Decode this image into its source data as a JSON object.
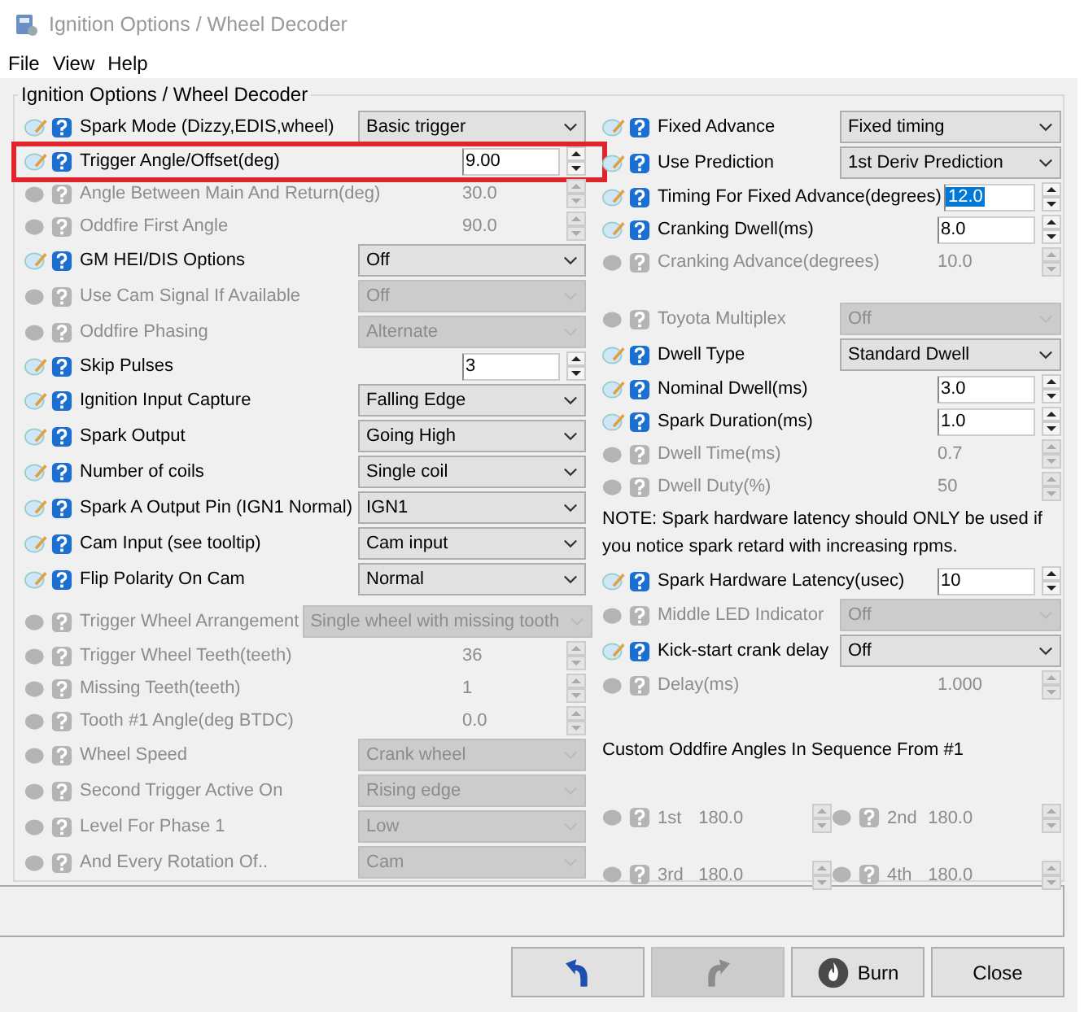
{
  "window": {
    "title": "Ignition Options / Wheel Decoder"
  },
  "menu": [
    "File",
    "View",
    "Help"
  ],
  "group": {
    "title": "Ignition Options / Wheel Decoder"
  },
  "left_rows": [
    {
      "kind": "select",
      "label": "Spark Mode (Dizzy,EDIS,wheel)",
      "value": "Basic trigger",
      "enabled": true
    },
    {
      "kind": "number",
      "label": "Trigger Angle/Offset(deg)",
      "value": "9.00",
      "enabled": true,
      "highlighted": true
    },
    {
      "kind": "number",
      "label": "Angle Between Main And Return(deg)",
      "value": "30.0",
      "enabled": false
    },
    {
      "kind": "number",
      "label": "Oddfire First Angle",
      "value": "90.0",
      "enabled": false
    },
    {
      "kind": "select",
      "label": "GM HEI/DIS Options",
      "value": "Off",
      "enabled": true
    },
    {
      "kind": "select",
      "label": "Use Cam Signal If Available",
      "value": "Off",
      "enabled": false
    },
    {
      "kind": "select",
      "label": "Oddfire Phasing",
      "value": "Alternate",
      "enabled": false
    },
    {
      "kind": "number",
      "label": "Skip Pulses",
      "value": "3",
      "enabled": true
    },
    {
      "kind": "select",
      "label": "Ignition Input Capture",
      "value": "Falling Edge",
      "enabled": true
    },
    {
      "kind": "select",
      "label": "Spark Output",
      "value": "Going High",
      "enabled": true
    },
    {
      "kind": "select",
      "label": "Number of coils",
      "value": "Single coil",
      "enabled": true
    },
    {
      "kind": "select",
      "label": "Spark A Output Pin (IGN1 Normal)",
      "value": "IGN1",
      "enabled": true
    },
    {
      "kind": "select",
      "label": "Cam Input (see tooltip)",
      "value": "Cam input",
      "enabled": true
    },
    {
      "kind": "select",
      "label": "Flip Polarity On Cam",
      "value": "Normal",
      "enabled": true
    },
    {
      "kind": "spacer"
    },
    {
      "kind": "select",
      "label": "Trigger Wheel Arrangement",
      "value": "Single wheel with missing tooth",
      "enabled": false
    },
    {
      "kind": "number",
      "label": "Trigger Wheel Teeth(teeth)",
      "value": "36",
      "enabled": false
    },
    {
      "kind": "number",
      "label": "Missing Teeth(teeth)",
      "value": "1",
      "enabled": false
    },
    {
      "kind": "number",
      "label": "Tooth #1 Angle(deg BTDC)",
      "value": "0.0",
      "enabled": false
    },
    {
      "kind": "select",
      "label": "Wheel Speed",
      "value": "Crank wheel",
      "enabled": false
    },
    {
      "kind": "select",
      "label": "Second Trigger Active On",
      "value": "Rising edge",
      "enabled": false
    },
    {
      "kind": "select",
      "label": "Level For Phase 1",
      "value": "Low",
      "enabled": false
    },
    {
      "kind": "select",
      "label": "And Every Rotation Of..",
      "value": "Cam",
      "enabled": false
    }
  ],
  "right_rows": [
    {
      "kind": "select",
      "label": "Fixed Advance",
      "value": "Fixed timing",
      "enabled": true
    },
    {
      "kind": "select",
      "label": "Use Prediction",
      "value": "1st Deriv Prediction",
      "enabled": true
    },
    {
      "kind": "number",
      "label": "Timing For Fixed Advance(degrees)",
      "value": "12.0",
      "enabled": true,
      "selected": true
    },
    {
      "kind": "number",
      "label": "Cranking Dwell(ms)",
      "value": "8.0",
      "enabled": true,
      "selected": false
    },
    {
      "kind": "number",
      "label": "Cranking Advance(degrees)",
      "value": "10.0",
      "enabled": false
    },
    {
      "kind": "spacer"
    },
    {
      "kind": "select",
      "label": "Toyota Multiplex",
      "value": "Off",
      "enabled": false
    },
    {
      "kind": "select",
      "label": "Dwell Type",
      "value": "Standard Dwell",
      "enabled": true
    },
    {
      "kind": "number",
      "label": "Nominal Dwell(ms)",
      "value": "3.0",
      "enabled": true,
      "selected": false
    },
    {
      "kind": "number",
      "label": "Spark Duration(ms)",
      "value": "1.0",
      "enabled": true,
      "selected": false
    },
    {
      "kind": "number",
      "label": "Dwell Time(ms)",
      "value": "0.7",
      "enabled": false
    },
    {
      "kind": "number",
      "label": "Dwell Duty(%)",
      "value": "50",
      "enabled": false
    },
    {
      "kind": "note",
      "text": "NOTE: Spark hardware latency should ONLY be used if you notice spark retard with increasing rpms."
    },
    {
      "kind": "number",
      "label": "Spark Hardware Latency(usec)",
      "value": "10",
      "enabled": true,
      "selected": false
    },
    {
      "kind": "select",
      "label": "Middle LED Indicator",
      "value": "Off",
      "enabled": false
    },
    {
      "kind": "select",
      "label": "Kick-start crank delay",
      "value": "Off",
      "enabled": true
    },
    {
      "kind": "number",
      "label": "Delay(ms)",
      "value": "1.000",
      "enabled": false
    },
    {
      "kind": "spacer"
    },
    {
      "kind": "heading",
      "text": "Custom Oddfire Angles In Sequence From #1"
    },
    {
      "kind": "pair",
      "items": [
        {
          "label": "1st",
          "value": "180.0",
          "enabled": false
        },
        {
          "label": "2nd",
          "value": "180.0",
          "enabled": false
        }
      ]
    },
    {
      "kind": "pair",
      "items": [
        {
          "label": "3rd",
          "value": "180.0",
          "enabled": false
        },
        {
          "label": "4th",
          "value": "180.0",
          "enabled": false
        }
      ]
    }
  ],
  "buttons": [
    {
      "kind": "undo",
      "disabled": false
    },
    {
      "kind": "redo",
      "disabled": true
    },
    {
      "kind": "burn",
      "label": "Burn",
      "disabled": false
    },
    {
      "kind": "close",
      "label": "Close",
      "disabled": false
    }
  ]
}
